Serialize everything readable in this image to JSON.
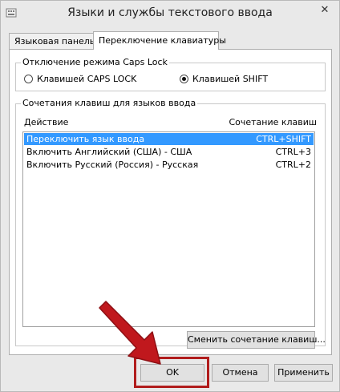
{
  "window": {
    "title": "Языки и службы текстового ввода",
    "close_glyph": "✕"
  },
  "tabs": [
    {
      "label": "Языковая панель",
      "active": false
    },
    {
      "label": "Переключение клавиатуры",
      "active": true
    }
  ],
  "caps_lock": {
    "legend": "Отключение режима Caps Lock",
    "options": [
      {
        "label": "Клавишей CAPS LOCK",
        "checked": false
      },
      {
        "label": "Клавишей SHIFT",
        "checked": true
      }
    ]
  },
  "hotkeys": {
    "legend": "Сочетания клавиш для языков ввода",
    "columns": {
      "action": "Действие",
      "combo": "Сочетание клавиш"
    },
    "rows": [
      {
        "action": "Переключить язык ввода",
        "combo": "CTRL+SHIFT",
        "selected": true
      },
      {
        "action": "Включить Английский (США) - США",
        "combo": "CTRL+3",
        "selected": false
      },
      {
        "action": "Включить Русский (Россия) - Русская",
        "combo": "CTRL+2",
        "selected": false
      }
    ],
    "change_button": "Сменить сочетание клавиш..."
  },
  "footer": {
    "ok": "OK",
    "cancel": "Отмена",
    "apply": "Применить"
  },
  "colors": {
    "selection": "#3399ff",
    "annotation": "#b11d1d"
  }
}
